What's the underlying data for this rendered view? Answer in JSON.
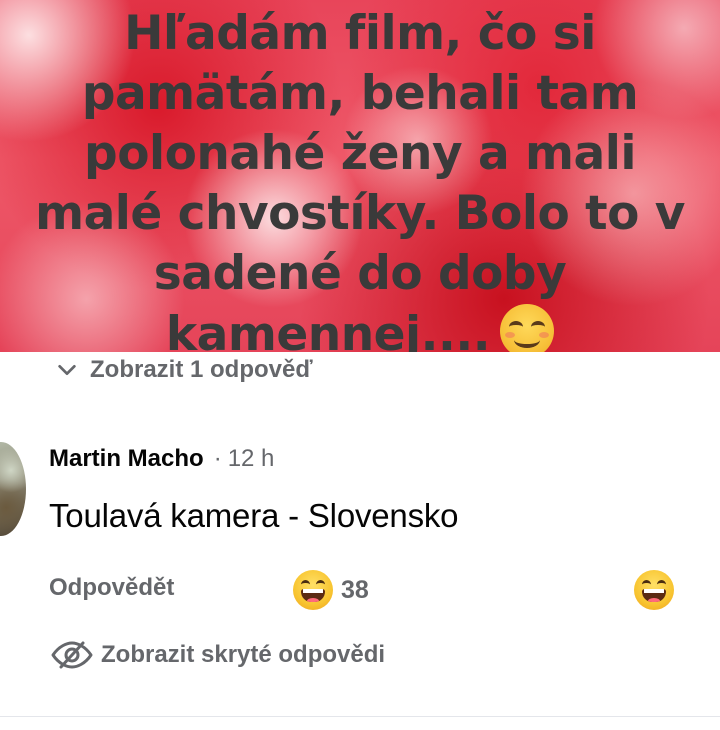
{
  "post": {
    "text": "Hľadám film, čo si pamätám, behali tam polonahé ženy a mali malé chvostíky. Bolo to v sadené do doby kamennej....",
    "emoji": "smiling-face-icon"
  },
  "replies_toggle": {
    "label": "Zobrazit 1 odpověď"
  },
  "comment": {
    "author": "Martin Macho",
    "separator": "·",
    "time": "12 h",
    "text": "Toulavá kamera - Slovensko",
    "reply_label": "Odpovědět",
    "reaction_icon": "laughing-face-icon",
    "reaction_count": "38"
  },
  "hidden_replies": {
    "label": "Zobrazit skryté odpovědi"
  },
  "colors": {
    "secondary_text": "#65676b",
    "primary_text": "#050505",
    "post_background": "#e8455a"
  }
}
